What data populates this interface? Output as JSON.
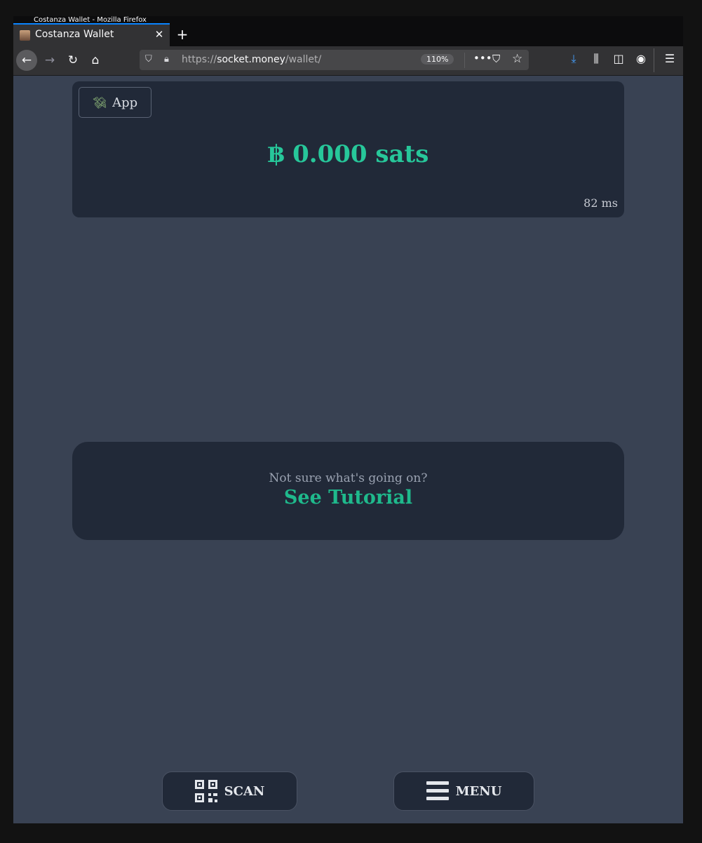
{
  "browser": {
    "window_title": "Costanza Wallet - Mozilla Firefox",
    "tab_title": "Costanza Wallet",
    "url_scheme": "https://",
    "url_host": "socket.money",
    "url_path": "/wallet/",
    "zoom": "110%"
  },
  "wallet": {
    "app_button_label": "App",
    "balance": "฿ 0.000 sats",
    "latency": "82 ms"
  },
  "tutorial": {
    "question": "Not sure what's going on?",
    "link_label": "See Tutorial"
  },
  "bottom_nav": {
    "scan_label": "SCAN",
    "menu_label": "MENU"
  },
  "colors": {
    "accent": "#27c79a",
    "card_bg": "#212938",
    "page_bg": "#394253"
  }
}
